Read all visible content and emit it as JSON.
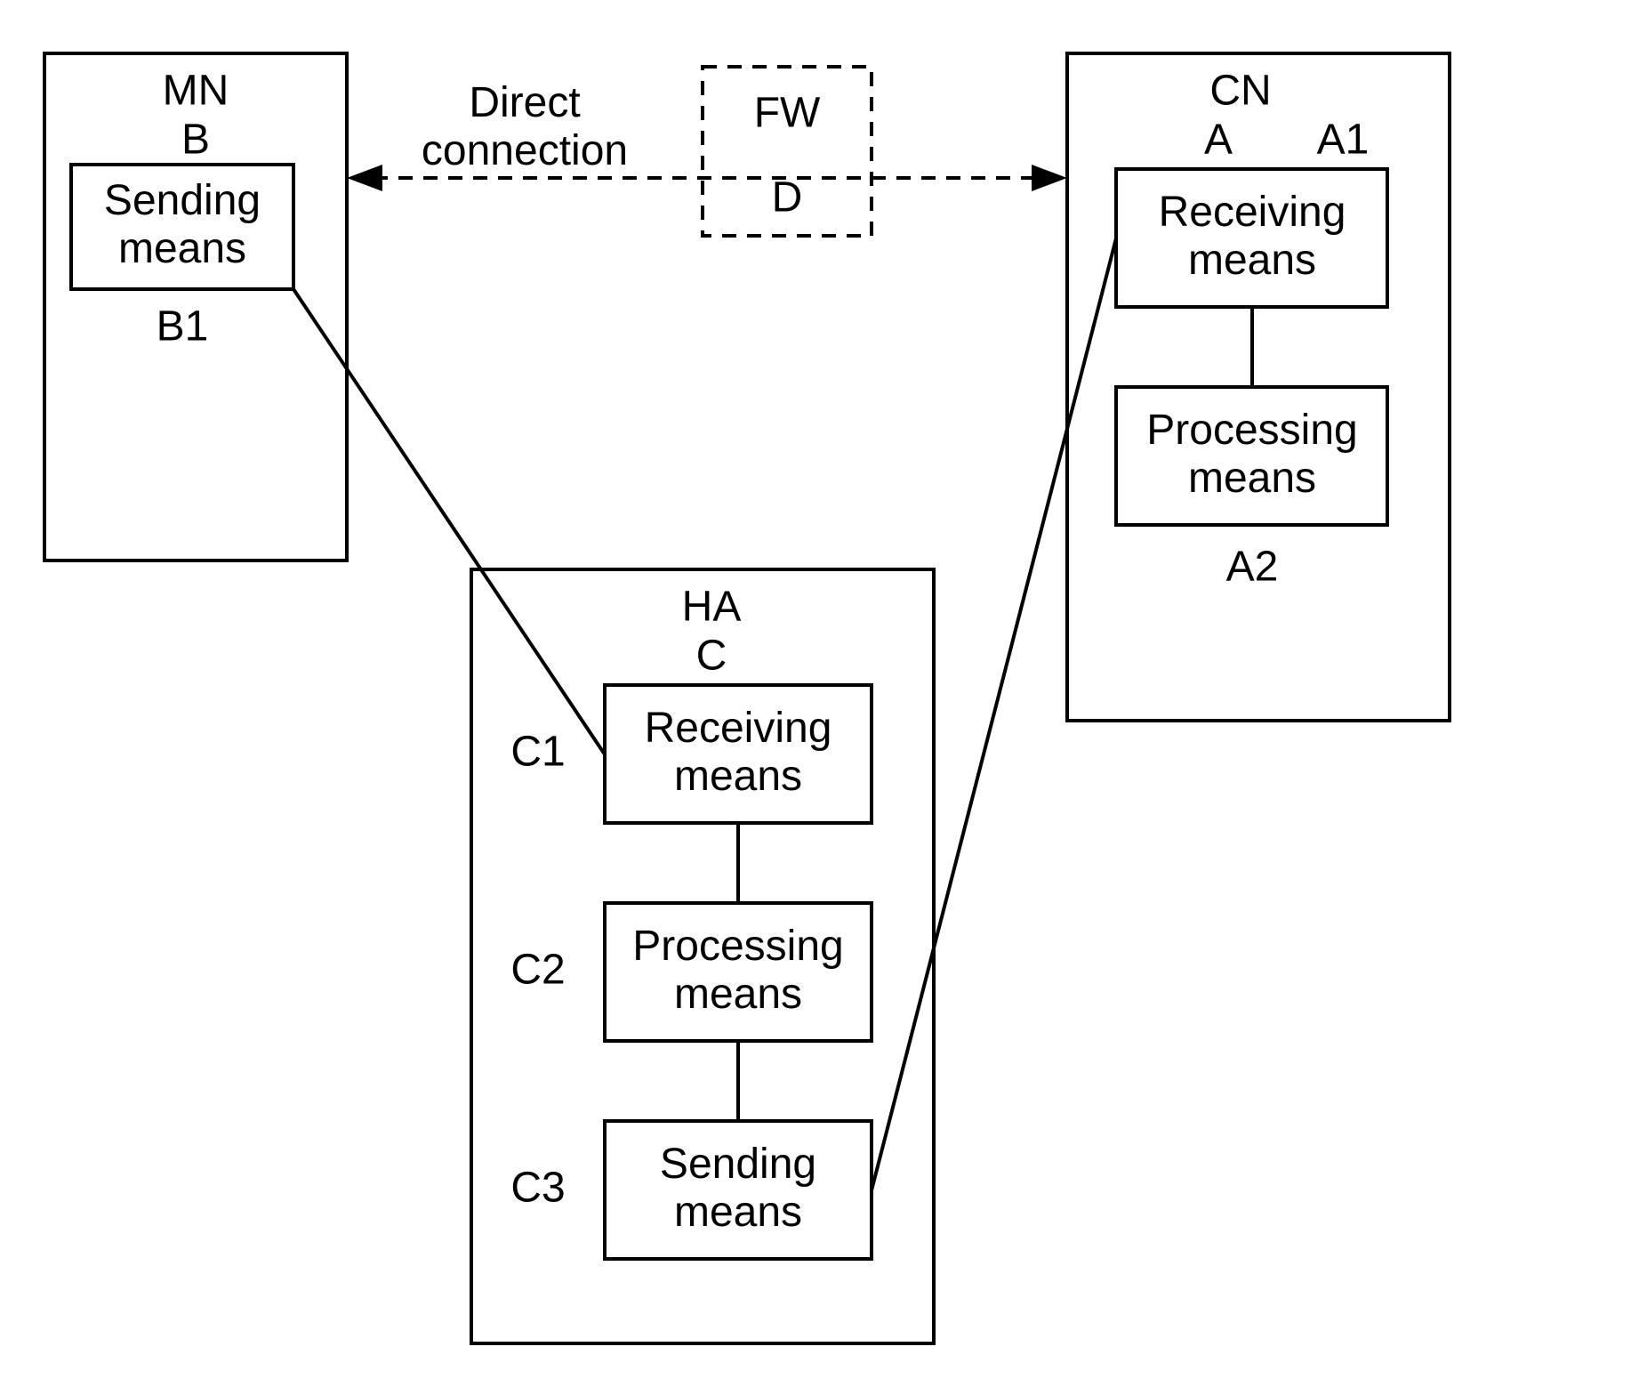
{
  "nodes": {
    "MN": {
      "title1": "MN",
      "title2": "B",
      "sending": "Sending\nmeans",
      "label_B1": "B1"
    },
    "CN": {
      "title1": "CN",
      "title2": "A",
      "label_A1": "A1",
      "receiving": "Receiving\nmeans",
      "processing": "Processing\nmeans",
      "label_A2": "A2"
    },
    "HA": {
      "title1": "HA",
      "title2": "C",
      "receiving": "Receiving\nmeans",
      "processing": "Processing\nmeans",
      "sending": "Sending\nmeans",
      "label_C1": "C1",
      "label_C2": "C2",
      "label_C3": "C3"
    },
    "FW": {
      "title1": "FW",
      "title2": "D"
    }
  },
  "labels": {
    "direct_connection": "Direct\nconnection"
  }
}
